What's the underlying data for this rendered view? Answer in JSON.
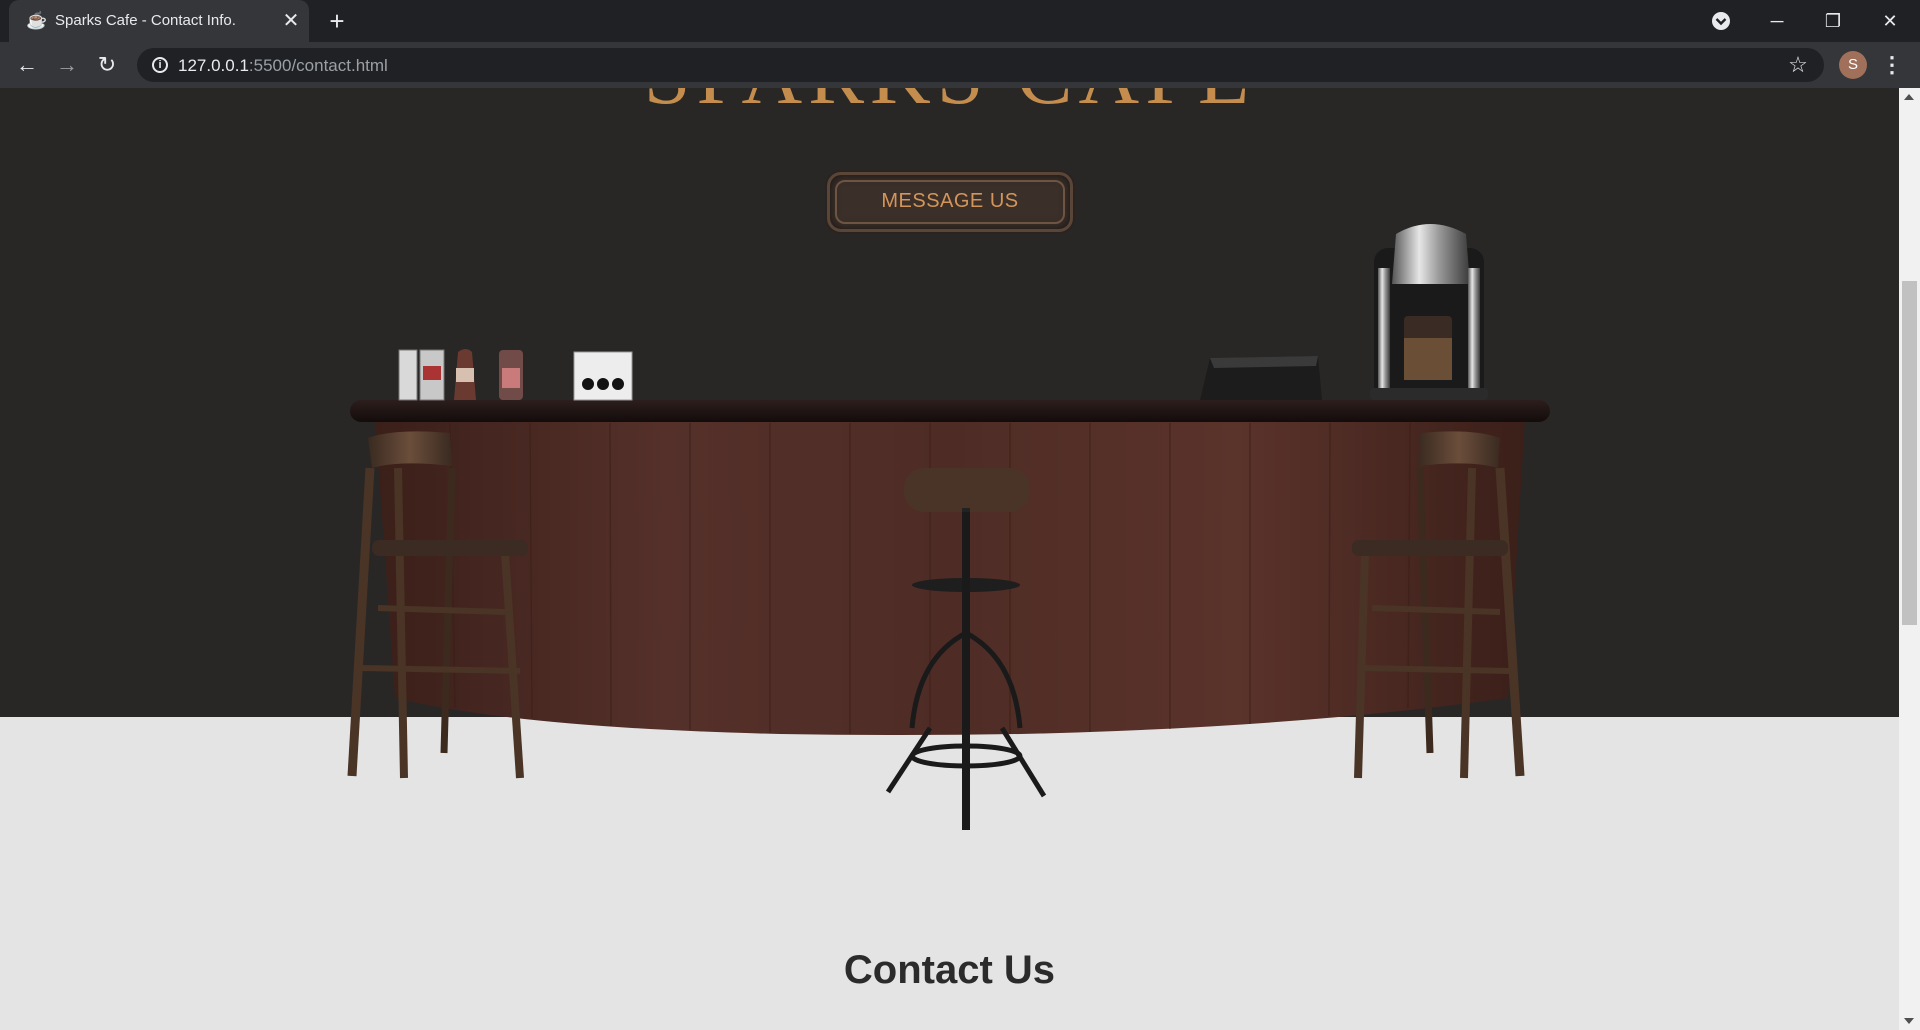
{
  "browser": {
    "tab_title": "Sparks Cafe - Contact Info.",
    "tab_close": "✕",
    "new_tab": "+",
    "url_host": "127.0.0.1",
    "url_path": ":5500/contact.html",
    "avatar_letter": "S",
    "icons": [
      "coffee-favicon-icon",
      "close-icon",
      "plus-icon",
      "tab-search-icon",
      "minimize-icon",
      "restore-icon",
      "close-window-icon",
      "back-icon",
      "forward-icon",
      "reload-icon",
      "info-icon",
      "star-icon",
      "menu-icon"
    ]
  },
  "page": {
    "brand": "SPARKS CAFE",
    "message_button": "MESSAGE US",
    "contact_heading": "Contact Us"
  },
  "colors": {
    "hero_bg": "#282726",
    "brand_gold": "#c48d4d",
    "page_bg": "#e4e4e4",
    "counter_wood": "#4a2a22"
  }
}
